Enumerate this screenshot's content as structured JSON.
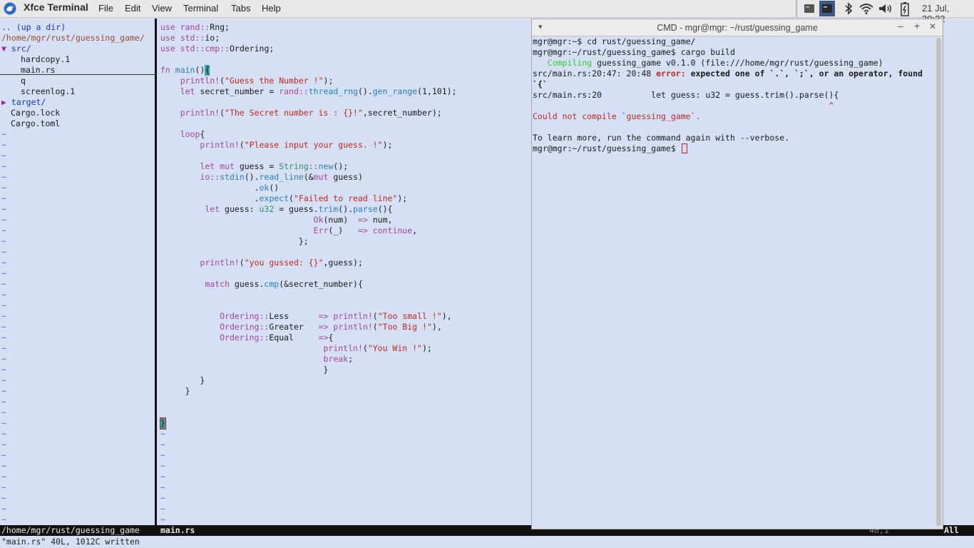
{
  "panel": {
    "app_title": "Xfce Terminal",
    "menu": [
      "File",
      "Edit",
      "View",
      "Terminal",
      "Tabs",
      "Help"
    ],
    "clock": "21 Jul, 20:22",
    "tray_icons": [
      "terminal-taskbar-icon",
      "terminal-taskbar-icon-active",
      "bluetooth-icon",
      "wifi-icon",
      "volume-icon",
      "battery-icon"
    ]
  },
  "tree": {
    "up": ".. (up a dir)",
    "path": "/home/mgr/rust/guessing_game/",
    "arrow_open": "▼",
    "arrow_closed": "▶",
    "src": "src/",
    "src_items": [
      "hardcopy.1",
      "main.rs",
      "q",
      "screenlog.1"
    ],
    "target": "target/",
    "root_files": [
      "Cargo.lock",
      "Cargo.toml"
    ]
  },
  "code": {
    "l1": [
      "use",
      " rand",
      "::",
      "Rng;"
    ],
    "l2": [
      "use",
      " std",
      "::",
      "io;"
    ],
    "l3": [
      "use",
      " std",
      "::",
      "cmp",
      "::",
      "Ordering;"
    ],
    "l5": [
      "fn",
      " main",
      "()",
      "{"
    ],
    "l6": [
      "    ",
      "println!",
      "(",
      "\"Guess the Number !\"",
      ");"
    ],
    "l7": [
      "    ",
      "let",
      " secret_number = ",
      "rand",
      "::",
      "thread_rng",
      "().",
      "gen_range",
      "(1,101);"
    ],
    "l9": [
      "    ",
      "println!",
      "(",
      "\"The Secret number is : {}!\"",
      ",secret_number);"
    ],
    "l11": [
      "    ",
      "loop",
      "{"
    ],
    "l12": [
      "        ",
      "println!",
      "(",
      "\"Please input your guess. !\"",
      ");"
    ],
    "l14": [
      "        ",
      "let",
      " ",
      "mut",
      " guess = ",
      "String",
      "::",
      "new",
      "();"
    ],
    "l15": [
      "        ",
      "io",
      "::",
      "stdin",
      "().",
      "read_line",
      "(&",
      "mut",
      " guess)"
    ],
    "l16": [
      "                   .",
      "ok",
      "()"
    ],
    "l17": [
      "                   .",
      "expect",
      "(",
      "\"Failed to read line\"",
      ");"
    ],
    "l18": [
      "         ",
      "let",
      " guess: ",
      "u32",
      " = guess.",
      "trim",
      "().",
      "parse",
      "(){"
    ],
    "l19": [
      "                               ",
      "Ok",
      "(num)  ",
      "=>",
      " num,"
    ],
    "l20": [
      "                               ",
      "Err",
      "(_)   ",
      "=>",
      " ",
      "continue",
      ","
    ],
    "l21": [
      "                            };"
    ],
    "l23": [
      "        ",
      "println!",
      "(",
      "\"you gussed: {}\"",
      ",guess);"
    ],
    "l25": [
      "         ",
      "match",
      " guess.",
      "cmp",
      "(&secret_number){"
    ],
    "l28": [
      "            ",
      "Ordering",
      "::",
      "Less",
      "      ",
      "=>",
      " ",
      "println!",
      "(",
      "\"Too small !\"",
      "),"
    ],
    "l29": [
      "            ",
      "Ordering",
      "::",
      "Greater",
      "   ",
      "=>",
      " ",
      "println!",
      "(",
      "\"Too Big !\"",
      "),"
    ],
    "l30": [
      "            ",
      "Ordering",
      "::",
      "Equal",
      "     ",
      "=>",
      "{"
    ],
    "l31": [
      "                                 ",
      "println!",
      "(",
      "\"You Win !\"",
      ");"
    ],
    "l32": [
      "                                 ",
      "break",
      ";"
    ],
    "l33": [
      "                                 }"
    ],
    "l35": [
      "        }"
    ],
    "l36": [
      "     }"
    ],
    "l40": [
      "}"
    ]
  },
  "tilde": "~",
  "status": {
    "left": "/home/mgr/rust/guessing_game",
    "file": "main.rs",
    "pos": "40,1",
    "scroll": "All"
  },
  "cmdline": "\"main.rs\" 40L, 1012C written",
  "term": {
    "title": "CMD - mgr@mgr: ~/rust/guessing_game",
    "btn_menu": "▾",
    "btn_min": "–",
    "btn_max": "+",
    "btn_close": "✕",
    "lines": {
      "t1": "mgr@mgr:~$ cd rust/guessing_game/",
      "t2": "mgr@mgr:~/rust/guessing_game$ cargo build",
      "t3a": "   Compiling",
      "t3b": " guessing_game v0.1.0 (file:///home/mgr/rust/guessing_game)",
      "t4a": "src/main.rs:20:47: 20:48 ",
      "t4b": "error:",
      "t4c": " expected one of `.`, `;`, or an operator, found",
      "t5": "`{`",
      "t6": "src/main.rs:20          let guess: u32 = guess.trim().parse(){",
      "t7": "                                                            ^",
      "t8": "Could not compile `guessing_game`.",
      "t9": "To learn more, run the command again with --verbose.",
      "t10": "mgr@mgr:~/rust/guessing_game$ "
    }
  },
  "colors": {
    "background": "#d6e0f4",
    "keyword": "#a0469e",
    "string": "#c0281a",
    "function": "#2b7fb5",
    "compiling": "#2cd12c",
    "error": "#c0281a"
  }
}
